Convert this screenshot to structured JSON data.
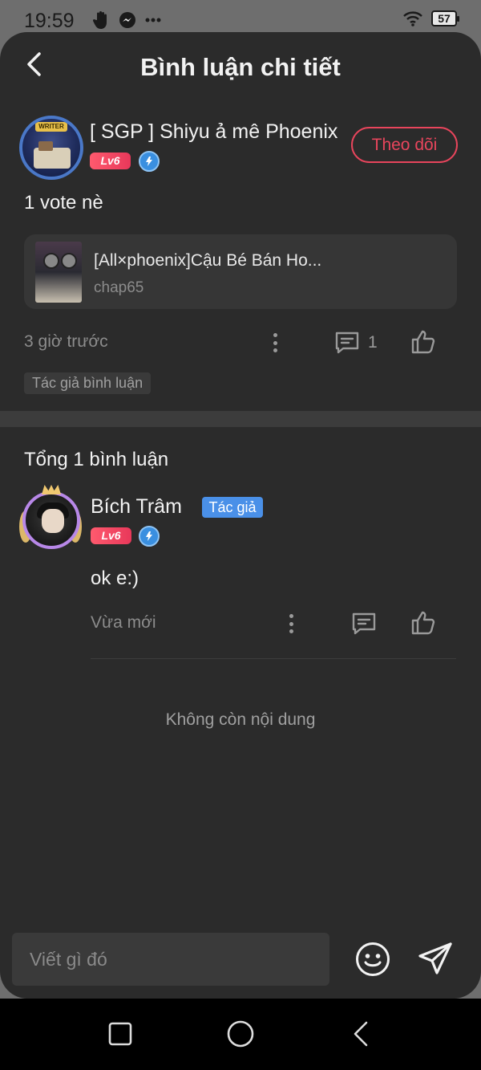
{
  "status_bar": {
    "time": "19:59",
    "battery": "57"
  },
  "header": {
    "title": "Bình luận chi tiết"
  },
  "main_comment": {
    "user_name": "[ SGP ] Shiyu ả mê Phoenix",
    "level": "Lv6",
    "follow_label": "Theo dõi",
    "text": "1 vote nè",
    "book": {
      "title": "[All×phoenix]Cậu Bé Bán Ho...",
      "chapter": "chap65"
    },
    "time": "3 giờ trước",
    "reply_count": "1",
    "tag": "Tác giả bình luận"
  },
  "replies": {
    "total_label": "Tổng 1 bình luận",
    "items": [
      {
        "user_name": "Bích Trâm",
        "author_tag": "Tác giả",
        "level": "Lv6",
        "text": "ok e:)",
        "time": "Vừa mới"
      }
    ],
    "end_label": "Không còn nội dung"
  },
  "input": {
    "placeholder": "Viết gì đó"
  },
  "colors": {
    "accent": "#e8455c",
    "author_tag": "#4a90e8",
    "background": "#2b2b2b"
  }
}
